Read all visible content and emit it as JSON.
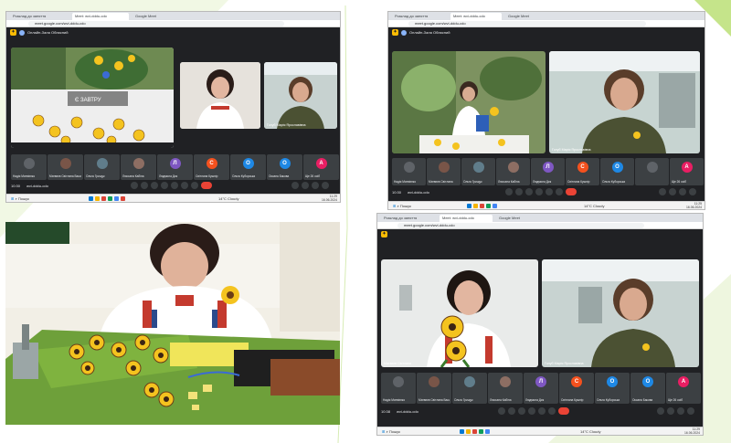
{
  "screen1": {
    "tabs": [
      "Розклад до заняття",
      "Meet: wvi-dddu-cdo",
      "Google Meet"
    ],
    "url": "meet.google.com/wvi-dddu-cdo",
    "meeting_title": "Онлайн-Зала Обласний",
    "shared_logo": "Є ЗАВТРУ",
    "speaker_name": "Голуб Марія Ярославівна",
    "participants": [
      {
        "initial": "",
        "name": "Надія Матвієнко",
        "color": "#5f6368"
      },
      {
        "initial": "",
        "name": "Матвєєв Світлана Васильова",
        "color": "#795548"
      },
      {
        "initial": "",
        "name": "Ольга Грищук",
        "color": "#607d8b"
      },
      {
        "initial": "",
        "name": "Люсьєна Кабіна",
        "color": "#8d6e63"
      },
      {
        "initial": "Л",
        "name": "Людмила Дик",
        "color": "#7e57c2"
      },
      {
        "initial": "С",
        "name": "Світлана Кушнір",
        "color": "#f4511e"
      },
      {
        "initial": "О",
        "name": "Ольга Куборська",
        "color": "#1e88e5"
      },
      {
        "initial": "О",
        "name": "Оксана Бакова",
        "color": "#1e88e5"
      },
      {
        "initial": "А",
        "name": "Ще 26 осіб",
        "color": "#e91e63"
      }
    ],
    "time": "10:30",
    "meeting_code": "wvi-dddu-cdo",
    "search_label": "Пошук",
    "weather": "14°C Cloudy",
    "clock_time": "11:29",
    "clock_date": "16.06.2024"
  },
  "screen2": {
    "tabs": [
      "Розклад до заняття",
      "Meet: wvi-dddu-cdo",
      "Google Meet"
    ],
    "url": "meet.google.com/wvi-dddu-cdo",
    "meeting_title": "Онлайн-Зала Обласний",
    "speaker_name": "Голуб Марія Ярославівна",
    "participants": [
      {
        "initial": "",
        "name": "Надія Матвієнко",
        "color": "#5f6368"
      },
      {
        "initial": "",
        "name": "Матвєєв Світлана",
        "color": "#795548"
      },
      {
        "initial": "",
        "name": "Ольга Грищук",
        "color": "#607d8b"
      },
      {
        "initial": "",
        "name": "Люсьєна Кабіна",
        "color": "#8d6e63"
      },
      {
        "initial": "Л",
        "name": "Людмила Дик",
        "color": "#7e57c2"
      },
      {
        "initial": "С",
        "name": "Світлана Кушнір",
        "color": "#f4511e"
      },
      {
        "initial": "О",
        "name": "Ольга Куборська",
        "color": "#1e88e5"
      },
      {
        "initial": "",
        "name": "",
        "color": "#5f6368"
      },
      {
        "initial": "А",
        "name": "Ще 26 осіб",
        "color": "#e91e63"
      }
    ],
    "time": "10:30",
    "meeting_code": "wvi-dddu-cdo",
    "search_label": "Пошук",
    "weather": "14°C Cloudy",
    "clock_time": "11:25",
    "clock_date": "16.06.2024"
  },
  "screen4": {
    "tabs": [
      "Розклад до заняття",
      "Meet: wvi-dddu-cdo",
      "Google Meet"
    ],
    "url": "meet.google.com/wvi-dddu-cdo",
    "presenter_name": "Матвєєв Світлана",
    "speaker_name": "Голуб Марія Ярославівна",
    "participants": [
      {
        "initial": "",
        "name": "Надія Матвієнко",
        "color": "#5f6368"
      },
      {
        "initial": "",
        "name": "Матвєєв Світлана Васильова",
        "color": "#795548"
      },
      {
        "initial": "",
        "name": "Ольга Грищук",
        "color": "#607d8b"
      },
      {
        "initial": "",
        "name": "Люсьєна Кабіна",
        "color": "#8d6e63"
      },
      {
        "initial": "Л",
        "name": "Людмила Дик",
        "color": "#7e57c2"
      },
      {
        "initial": "С",
        "name": "Світлана Кушнір",
        "color": "#f4511e"
      },
      {
        "initial": "О",
        "name": "Ольга Куборська",
        "color": "#1e88e5"
      },
      {
        "initial": "О",
        "name": "Оксана Бакова",
        "color": "#1e88e5"
      },
      {
        "initial": "А",
        "name": "Ще 26 осіб",
        "color": "#e91e63"
      }
    ],
    "time": "10:38",
    "meeting_code": "wvi-dddu-cdo",
    "search_label": "Пошук",
    "weather": "14°C Cloudy",
    "clock_time": "11:29",
    "clock_date": "16.06.2024"
  },
  "colors": {
    "meet_bg": "#202124",
    "tile_bg": "#3c4043",
    "end_call": "#ea4335",
    "slide_green": "#c5e48a"
  }
}
